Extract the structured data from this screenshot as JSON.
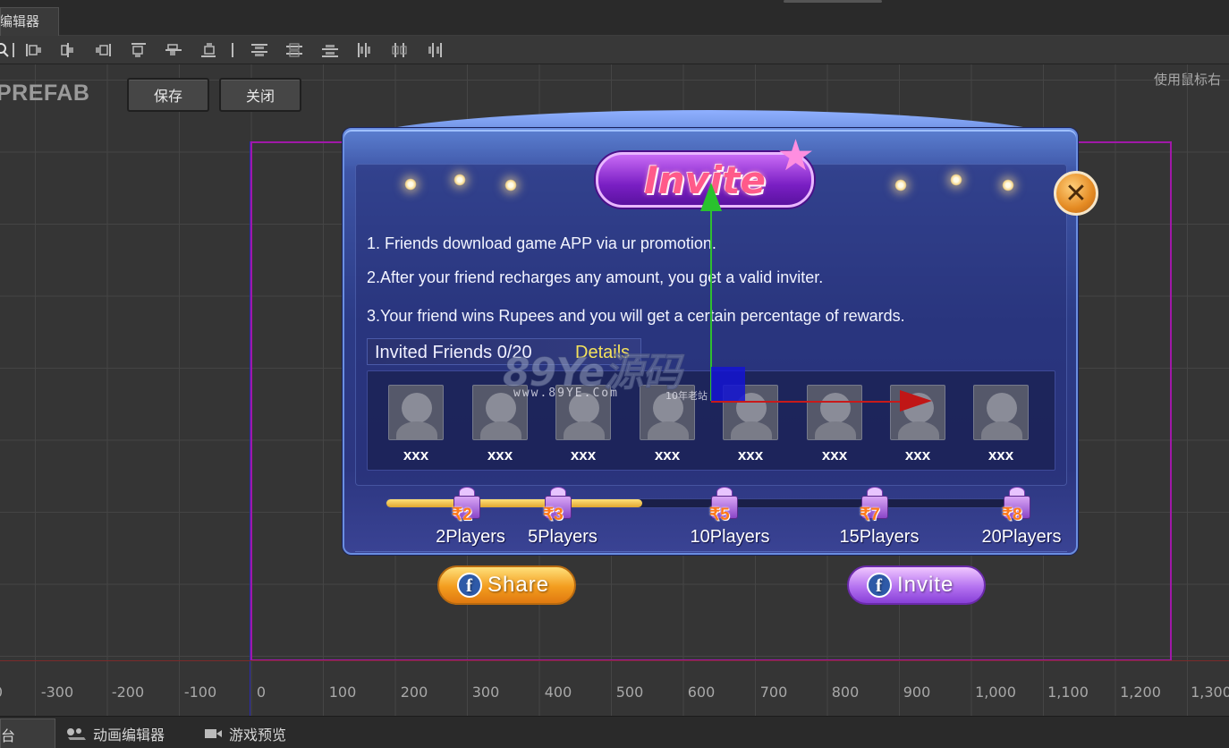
{
  "tabbar": {
    "active_tab": "编辑器"
  },
  "toolbar": {
    "tools": [
      "search-icon",
      "align-left-icon",
      "align-center-h-icon",
      "align-right-icon",
      "align-top-icon",
      "align-middle-v-icon",
      "align-bottom-icon",
      "distribute-top-icon",
      "distribute-center-v-icon",
      "distribute-bottom-icon",
      "distribute-left-icon",
      "distribute-center-h-icon",
      "distribute-right-icon"
    ]
  },
  "editor": {
    "mode_label": "PREFAB",
    "save_label": "保存",
    "close_label": "关闭",
    "hint_text": "使用鼠标右"
  },
  "ruler": {
    "labels": [
      "0",
      "-300",
      "-200",
      "-100",
      "0",
      "100",
      "200",
      "300",
      "400",
      "500",
      "600",
      "700",
      "800",
      "900",
      "1,000",
      "1,100",
      "1,200",
      "1,300"
    ]
  },
  "dialog": {
    "title": "Invite",
    "close_symbol": "✕",
    "lines": [
      "1. Friends download game APP via ur promotion.",
      "2.After your friend recharges any amount, you get a valid inviter.",
      "3.Your friend wins Rupees and you will get a certain percentage of rewards."
    ],
    "invited_label": "Invited Friends  0/20",
    "details_label": "Details",
    "friends": [
      "xxx",
      "xxx",
      "xxx",
      "xxx",
      "xxx",
      "xxx",
      "xxx",
      "xxx"
    ],
    "progress": 0.41,
    "milestones": [
      {
        "reward": "₹2",
        "label": "2Players"
      },
      {
        "reward": "₹3",
        "label": "5Players"
      },
      {
        "reward": "₹5",
        "label": "10Players"
      },
      {
        "reward": "₹7",
        "label": "15Players"
      },
      {
        "reward": "₹8",
        "label": "20Players"
      }
    ],
    "share_label": "Share",
    "invite_label": "Invite",
    "fb_glyph": "f"
  },
  "watermark": {
    "big": "89Ye源码",
    "url": "www.89YE.Com",
    "tag": "10年老站"
  },
  "bottombar": {
    "tabs": [
      "台",
      "动画编辑器",
      "游戏预览"
    ]
  },
  "colors": {
    "design_frame": "#a018a8",
    "gizmo_y": "#29c22e",
    "gizmo_x": "#c01616",
    "progress": "#f5c548"
  }
}
